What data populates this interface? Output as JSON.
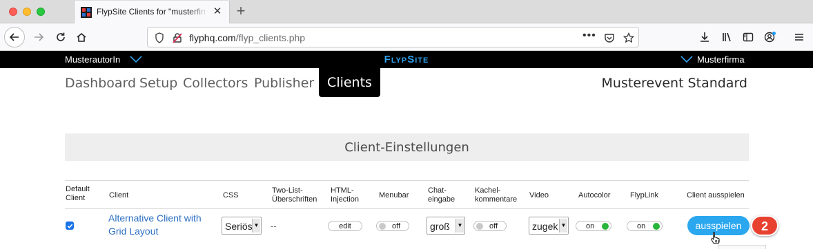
{
  "browser": {
    "tab_title": "FlypSite Clients for \"musterfirma",
    "url_host": "flyphq.com",
    "url_path": "/flyp_clients.php",
    "url_more": "•••"
  },
  "topbar": {
    "author": "MusterautorIn",
    "brand": "FlypSite",
    "company": "Musterfirma"
  },
  "nav": {
    "items": [
      "Dashboard",
      "Setup",
      "Collectors",
      "Publisher",
      "Clients"
    ],
    "active": "Clients",
    "event": "Musterevent Standard"
  },
  "section": {
    "title": "Client-Einstellungen"
  },
  "table": {
    "headers": {
      "default_client": [
        "Default",
        "Client"
      ],
      "client": "Client",
      "css": "CSS",
      "two_list": [
        "Two-List-",
        "Überschriften"
      ],
      "html_injection": [
        "HTML-",
        "Injection"
      ],
      "menubar": "Menubar",
      "chat": [
        "Chat-",
        "eingabe"
      ],
      "kachel": [
        "Kachel-",
        "kommentare"
      ],
      "video": "Video",
      "autocolor": "Autocolor",
      "flyplink": "FlypLink",
      "play": "Client ausspielen"
    },
    "row": {
      "default_checked": true,
      "client_name": "Alternative Client with Grid Layout",
      "css_value": "Seriös",
      "two_list_value": "--",
      "html_injection_label": "edit",
      "menubar_label": "off",
      "chat_value": "groß",
      "kachel_label": "off",
      "video_value": "zugek",
      "autocolor_label": "on",
      "flyplink_label": "on",
      "play_label": "ausspielen"
    }
  },
  "annotation": {
    "step": "2"
  },
  "colors": {
    "brand": "#2ea3ee",
    "link": "#2b6fc2",
    "button": "#2ba7ef",
    "toggle_on": "#27b53a",
    "badge": "#e8412f"
  }
}
